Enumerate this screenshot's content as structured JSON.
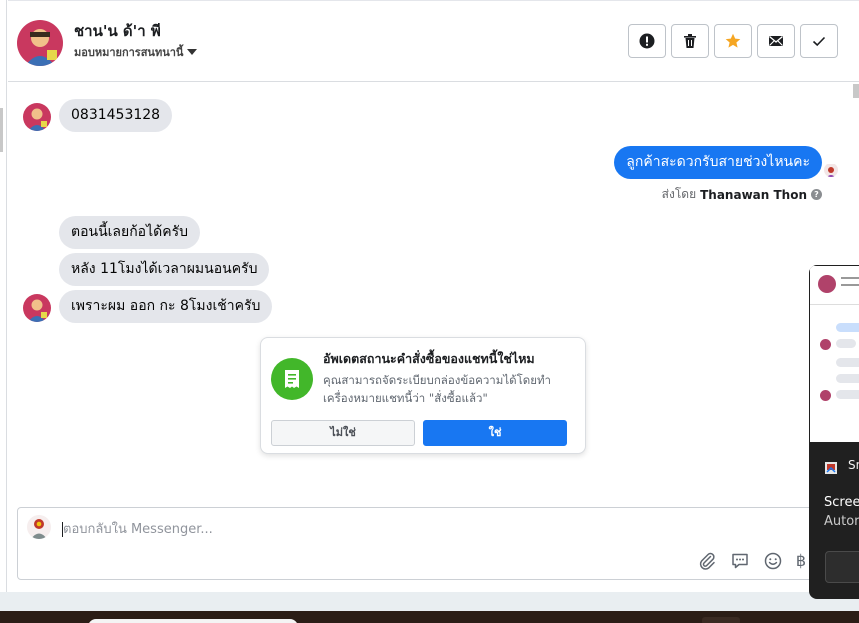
{
  "header": {
    "contact_name": "ชาน'น ด้'า พี",
    "assign_label": "มอบหมายการสนทนานี้",
    "actions": [
      {
        "icon": "alert-icon",
        "label": "mark-spam"
      },
      {
        "icon": "trash-icon",
        "label": "delete"
      },
      {
        "icon": "star-icon",
        "label": "follow-up",
        "color": "#f5a623"
      },
      {
        "icon": "envelope-icon",
        "label": "mark-unread"
      },
      {
        "icon": "check-icon",
        "label": "done"
      }
    ]
  },
  "messages": {
    "m1": "0831453128",
    "m2": "ลูกค้าสะดวกรับสายช่วงไหนคะ",
    "sent_by_prefix": "ส่งโดย",
    "sent_by_name": "Thanawan Thon",
    "help": "?",
    "m3": "ตอนนี้เลยก้อได้ครับ",
    "m4": "หลัง 11โมงได้เวลาผมนอนครับ",
    "m5": "เพราะผม ออก กะ 8โมงเช้าครับ"
  },
  "prompt": {
    "title": "อัพเดตสถานะคำสั่งซื้อของแชทนี้ใช่ไหม",
    "body": "คุณสามารถจัดระเบียบกล่องข้อความได้โดยทำเครื่องหมายแชทนี้ว่า \"สั่งซื้อแล้ว\"",
    "no_label": "ไม่ใช่",
    "yes_label": "ใช่"
  },
  "composer": {
    "placeholder": "ตอบกลับใน Messenger...",
    "tools": [
      "paperclip-icon",
      "saved-reply-icon",
      "emoji-icon",
      "baht-icon"
    ],
    "baht_glyph": "฿"
  },
  "notification": {
    "app_name": "Sn",
    "title": "Scree",
    "subtitle": "Autor"
  },
  "colors": {
    "brand_blue": "#1877f2",
    "incoming_bubble": "#e4e6eb",
    "success_green": "#42b72a",
    "star_orange": "#f5a623"
  }
}
